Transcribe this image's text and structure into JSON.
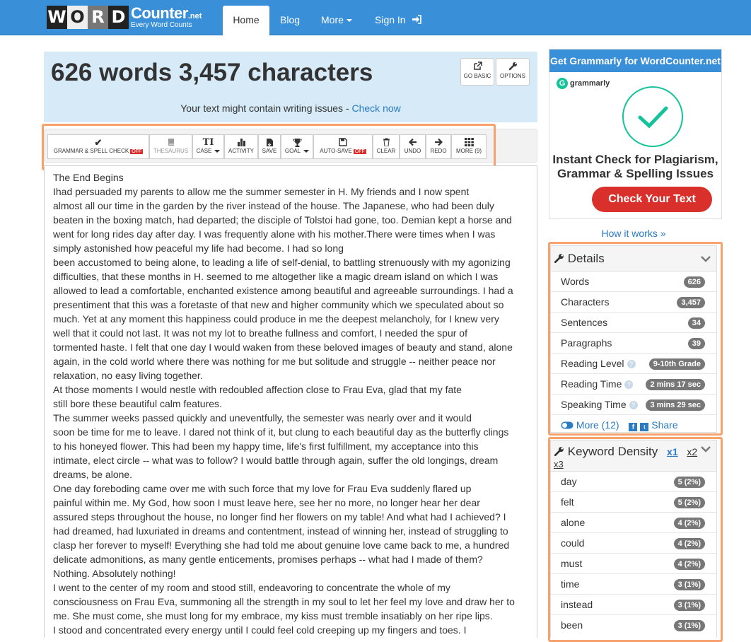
{
  "nav": {
    "logo_letters": [
      "W",
      "O",
      "R",
      "D"
    ],
    "logo_brand": "Counter",
    "logo_tld": ".net",
    "logo_tagline": "Every Word Counts",
    "items": [
      {
        "label": "Home",
        "active": true
      },
      {
        "label": "Blog"
      },
      {
        "label": "More"
      },
      {
        "label": "Sign In"
      }
    ]
  },
  "counter": {
    "title": "626 words 3,457 characters",
    "go_basic": "GO BASIC",
    "options": "OPTIONS",
    "note": "Your text might contain writing issues - ",
    "note_link": "Check now"
  },
  "toolbar": [
    {
      "label": "GRAMMAR & SPELL CHECK",
      "badge": "OFF",
      "icon": "check-icon"
    },
    {
      "label": "THESAURUS",
      "icon": "book-icon",
      "disabled": true
    },
    {
      "label": "CASE",
      "icon": "text-case-icon",
      "dropdown": true
    },
    {
      "label": "ACTIVITY",
      "icon": "bar-chart-icon"
    },
    {
      "label": "SAVE",
      "icon": "save-file-icon"
    },
    {
      "label": "GOAL",
      "icon": "trophy-icon",
      "dropdown": true
    },
    {
      "label": "AUTO-SAVE",
      "badge": "OFF",
      "icon": "floppy-icon"
    },
    {
      "label": "CLEAR",
      "icon": "trash-icon"
    },
    {
      "label": "UNDO",
      "icon": "arrow-left-icon"
    },
    {
      "label": "REDO",
      "icon": "arrow-right-icon"
    },
    {
      "label": "MORE (9)",
      "icon": "grid-icon"
    }
  ],
  "editor_text": "The End Begins\nIhad persuaded my parents to allow me the summer semester in H. My friends and I now spent\nalmost all our time in the garden by the river instead of the house. The Japanese, who had been duly\nbeaten in the boxing match, had departed; the disciple of Tolstoi had gone, too. Demian kept a horse and\nwent for long rides day after day. I was frequently alone with his mother.There were times when I was\nsimply astonished how peaceful my life had become. I had so long\nbeen accustomed to being alone, to leading a life of self-denial, to battling strenuously with my agonizing\ndifficulties, that these months in H. seemed to me altogether like a magic dream island on which I was\nallowed to lead a comfortable, enchanted existence among beautiful and agreeable surroundings. I had a\npresentiment that this was a foretaste of that new and higher community which we speculated about so\nmuch. Yet at any moment this happiness could produce in me the deepest melancholy, for I knew very\nwell that it could not last. It was not my lot to breathe fullness and comfort, I needed the spur of\ntormented haste. I felt that one day I would waken from these beloved images of beauty and stand, alone\nagain, in the cold world where there was nothing for me but solitude and struggle -- neither peace nor\nrelaxation, no easy living together.\nAt those moments I would nestle with redoubled affection close to Frau Eva, glad that my fate\nstill bore these beautiful calm features.\nThe summer weeks passed quickly and uneventfully, the semester was nearly over and it would\nsoon be time for me to leave. I dared not think of it, but clung to each beautiful day as the butterfly clings\nto his honeyed flower. This had been my happy time, life's first fulfillment, my acceptance into this\nintimate, elect circle -- what was to follow? I would battle through again, suffer the old longings, dream\ndreams, be alone.\nOne day foreboding came over me with such force that my love for Frau Eva suddenly flared up\npainful within me. My God, how soon I must leave here, see her no more, no longer hear her dear\nassured steps throughout the house, no longer find her flowers on my table! And what had I achieved? I\nhad dreamed, had luxuriated in dreams and contentment, instead of winning her, instead of struggling to\nclasp her forever to myself! Everything she had told me about genuine love came back to me, a hundred\ndelicate admonitions, as many gentle enticements, promises perhaps -- what had I made of them?\nNothing. Absolutely nothing!\nI went to the center of my room and stood still, endeavoring to concentrate the whole of my\nconsciousness on Frau Eva, summoning all the strength in my soul to let her feel my love and draw her to\nme. She must come, she must long for my embrace, my kiss must tremble insatiably on her ripe lips.\nI stood and concentrated every energy until I could feel cold creeping up my fingers and toes. I",
  "ad": {
    "header": "Get Grammarly for WordCounter.net",
    "brand": "grammarly",
    "headline": "Instant Check for Plagiarism, Grammar & Spelling Issues",
    "cta": "Check Your Text",
    "how_it_works": "How it works »"
  },
  "details": {
    "title": "Details",
    "rows": [
      {
        "label": "Words",
        "value": "626"
      },
      {
        "label": "Characters",
        "value": "3,457"
      },
      {
        "label": "Sentences",
        "value": "34"
      },
      {
        "label": "Paragraphs",
        "value": "39"
      },
      {
        "label": "Reading Level",
        "value": "9-10th Grade",
        "help": true
      },
      {
        "label": "Reading Time",
        "value": "2 mins 17 sec",
        "help": true
      },
      {
        "label": "Speaking Time",
        "value": "3 mins 29 sec",
        "help": true
      }
    ],
    "more": "More (12)",
    "share": "Share"
  },
  "keyword_density": {
    "title": "Keyword Density",
    "options": [
      "x1",
      "x2",
      "x3"
    ],
    "rows": [
      {
        "word": "day",
        "value": "5 (2%)"
      },
      {
        "word": "felt",
        "value": "5 (2%)"
      },
      {
        "word": "alone",
        "value": "4 (2%)"
      },
      {
        "word": "could",
        "value": "4 (2%)"
      },
      {
        "word": "must",
        "value": "4 (2%)"
      },
      {
        "word": "time",
        "value": "3 (1%)"
      },
      {
        "word": "instead",
        "value": "3 (1%)"
      },
      {
        "word": "been",
        "value": "3 (1%)"
      }
    ]
  },
  "colors": {
    "nav": "#3a8fd9",
    "highlight": "#f7a26d",
    "off_badge": "#d9302b",
    "link": "#2a7bc4"
  }
}
